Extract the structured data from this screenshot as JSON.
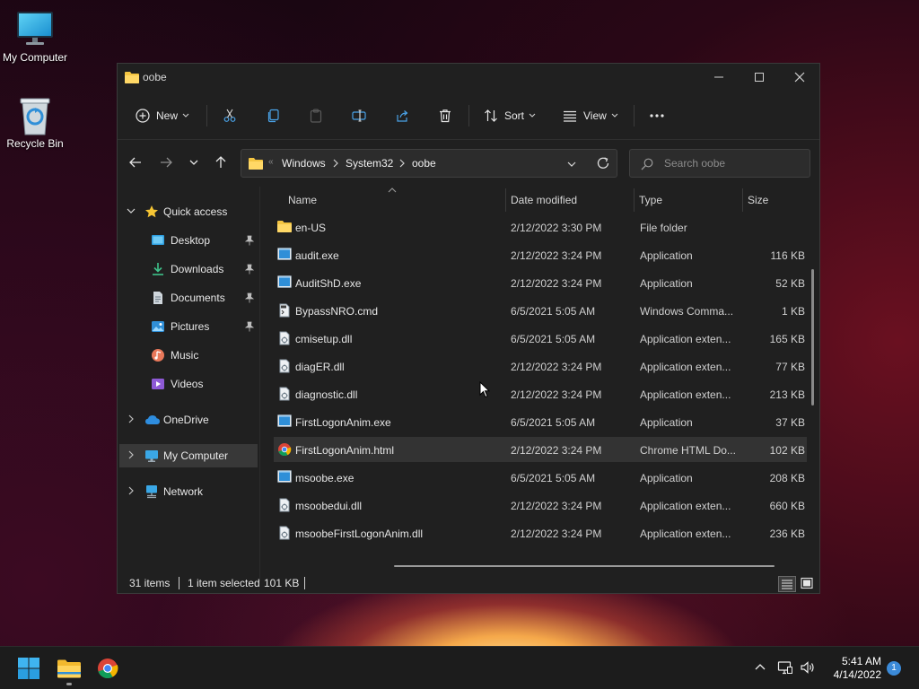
{
  "desktop": {
    "icons": [
      {
        "label": "My Computer",
        "icon": "monitor-icon"
      },
      {
        "label": "Recycle Bin",
        "icon": "recycle-bin-icon"
      }
    ]
  },
  "window": {
    "title": "oobe",
    "toolbar": {
      "new_label": "New",
      "sort_label": "Sort",
      "view_label": "View",
      "icons": [
        "new-icon",
        "cut-icon",
        "copy-icon",
        "paste-icon",
        "rename-icon",
        "share-icon",
        "delete-icon",
        "sort-icon",
        "view-icon",
        "more-icon"
      ]
    },
    "address": {
      "overflow_glyph": "«",
      "crumbs": [
        "Windows",
        "System32",
        "oobe"
      ],
      "search_placeholder": "Search oobe"
    },
    "nav": {
      "quick_access": "Quick access",
      "items": [
        {
          "label": "Desktop",
          "icon": "desktop-folder-icon",
          "pinned": true
        },
        {
          "label": "Downloads",
          "icon": "downloads-folder-icon",
          "pinned": true
        },
        {
          "label": "Documents",
          "icon": "documents-folder-icon",
          "pinned": true
        },
        {
          "label": "Pictures",
          "icon": "pictures-folder-icon",
          "pinned": true
        },
        {
          "label": "Music",
          "icon": "music-folder-icon",
          "pinned": false
        },
        {
          "label": "Videos",
          "icon": "videos-folder-icon",
          "pinned": false
        }
      ],
      "onedrive": "OneDrive",
      "my_computer": "My Computer",
      "network": "Network"
    },
    "columns": {
      "name": "Name",
      "date": "Date modified",
      "type": "Type",
      "size": "Size"
    },
    "files": [
      {
        "name": "en-US",
        "date": "2/12/2022 3:30 PM",
        "type": "File folder",
        "size": "",
        "icon": "folder-icon"
      },
      {
        "name": "audit.exe",
        "date": "2/12/2022 3:24 PM",
        "type": "Application",
        "size": "116 KB",
        "icon": "exe-icon"
      },
      {
        "name": "AuditShD.exe",
        "date": "2/12/2022 3:24 PM",
        "type": "Application",
        "size": "52 KB",
        "icon": "exe-icon"
      },
      {
        "name": "BypassNRO.cmd",
        "date": "6/5/2021 5:05 AM",
        "type": "Windows Comma...",
        "size": "1 KB",
        "icon": "cmd-icon"
      },
      {
        "name": "cmisetup.dll",
        "date": "6/5/2021 5:05 AM",
        "type": "Application exten...",
        "size": "165 KB",
        "icon": "dll-icon"
      },
      {
        "name": "diagER.dll",
        "date": "2/12/2022 3:24 PM",
        "type": "Application exten...",
        "size": "77 KB",
        "icon": "dll-icon"
      },
      {
        "name": "diagnostic.dll",
        "date": "2/12/2022 3:24 PM",
        "type": "Application exten...",
        "size": "213 KB",
        "icon": "dll-icon"
      },
      {
        "name": "FirstLogonAnim.exe",
        "date": "6/5/2021 5:05 AM",
        "type": "Application",
        "size": "37 KB",
        "icon": "exe-icon"
      },
      {
        "name": "FirstLogonAnim.html",
        "date": "2/12/2022 3:24 PM",
        "type": "Chrome HTML Do...",
        "size": "102 KB",
        "icon": "chrome-html-icon",
        "selected": true
      },
      {
        "name": "msoobe.exe",
        "date": "6/5/2021 5:05 AM",
        "type": "Application",
        "size": "208 KB",
        "icon": "exe-icon"
      },
      {
        "name": "msoobedui.dll",
        "date": "2/12/2022 3:24 PM",
        "type": "Application exten...",
        "size": "660 KB",
        "icon": "dll-icon"
      },
      {
        "name": "msoobeFirstLogonAnim.dll",
        "date": "2/12/2022 3:24 PM",
        "type": "Application exten...",
        "size": "236 KB",
        "icon": "dll-icon"
      }
    ],
    "status": {
      "items_count": "31 items",
      "selection": "1 item selected",
      "selected_size": "101 KB"
    }
  },
  "taskbar": {
    "apps": [
      "start-icon",
      "file-explorer-icon",
      "chrome-icon"
    ],
    "tray_icons": [
      "chevron-up-icon",
      "network-icon",
      "volume-icon"
    ],
    "time": "5:41 AM",
    "date": "4/14/2022",
    "notifications": "1"
  }
}
